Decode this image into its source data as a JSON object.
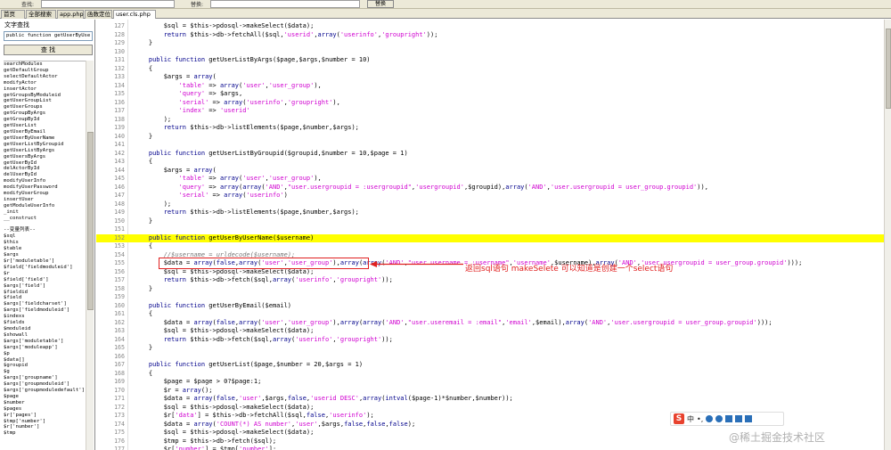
{
  "topbar": {
    "find_label": "查找:",
    "replace_label": "替换:",
    "replace_button": "替换"
  },
  "tabs": [
    "首页",
    "全部搜索",
    "app.php",
    "函数定位",
    "user.cls.php"
  ],
  "left_panel": {
    "title": "文字查找",
    "search_value": "public function getUserByUse",
    "find_button": "查 找",
    "items": [
      "searchModules",
      "getDefaultGroup",
      "selectDefaultActor",
      "modifyActor",
      "insertActor",
      "getGroupsByModuleid",
      "getUserGroupList",
      "getUserGroups",
      "getGroupByArgs",
      "getGroupById",
      "getUserList",
      "getUserByEmail",
      "getUserByUserName",
      "getUserListByGroupid",
      "getUserListByArgs",
      "getUsersByArgs",
      "getUserById",
      "delActorById",
      "delUserById",
      "modifyUserInfo",
      "modifyUserPassword",
      "modifyUserGroup",
      "insertUser",
      "getModuleUserInfo",
      "_init",
      "__construct",
      "",
      "--变量列表--",
      "$sql",
      "$this",
      "$table",
      "$args",
      "$r['moduletable']",
      "$field['fieldmoduleid']",
      "$r",
      "$field['field']",
      "$args['field']",
      "$fieldid",
      "$field",
      "$args['fieldcharset']",
      "$args['fieldmoduleid']",
      "$indexs",
      "$fields",
      "$moduleid",
      "$showall",
      "$args['moduletable']",
      "$args['moduleapp']",
      "$p",
      "$data[]",
      "$groupid",
      "$g",
      "$args['groupname']",
      "$args['groupmoduleid']",
      "$args['groupmoduledefault']",
      "$page",
      "$number",
      "$pages",
      "$r['pages']",
      "$tmp['number']",
      "$r['number']",
      "$tmp"
    ]
  },
  "editor": {
    "lines": [
      {
        "n": "127",
        "code": "        $sql = $this->pdosql->makeSelect($data);"
      },
      {
        "n": "128",
        "code": "        return $this->db->fetchAll($sql,'userid',array('userinfo','groupright'));"
      },
      {
        "n": "129",
        "code": "    }"
      },
      {
        "n": "130",
        "code": ""
      },
      {
        "n": "131",
        "code": "    public function getUserListByArgs($page,$args,$number = 10)"
      },
      {
        "n": "132",
        "code": "    {"
      },
      {
        "n": "133",
        "code": "        $args = array("
      },
      {
        "n": "134",
        "code": "            'table' => array('user','user_group'),"
      },
      {
        "n": "135",
        "code": "            'query' => $args,"
      },
      {
        "n": "136",
        "code": "            'serial' => array('userinfo','groupright'),"
      },
      {
        "n": "137",
        "code": "            'index' => 'userid'"
      },
      {
        "n": "138",
        "code": "        );"
      },
      {
        "n": "139",
        "code": "        return $this->db->listElements($page,$number,$args);"
      },
      {
        "n": "140",
        "code": "    }"
      },
      {
        "n": "141",
        "code": ""
      },
      {
        "n": "142",
        "code": "    public function getUserListByGroupid($groupid,$number = 10,$page = 1)"
      },
      {
        "n": "143",
        "code": "    {"
      },
      {
        "n": "144",
        "code": "        $args = array("
      },
      {
        "n": "145",
        "code": "            'table' => array('user','user_group'),"
      },
      {
        "n": "146",
        "code": "            'query' => array(array('AND',\"user.usergroupid = :usergroupid\",'usergroupid',$groupid),array('AND','user.usergroupid = user_group.groupid')),"
      },
      {
        "n": "147",
        "code": "            'serial' => array('userinfo')"
      },
      {
        "n": "148",
        "code": "        );"
      },
      {
        "n": "149",
        "code": "        return $this->db->listElements($page,$number,$args);"
      },
      {
        "n": "150",
        "code": "    }"
      },
      {
        "n": "151",
        "code": ""
      },
      {
        "n": "152",
        "code": "    public function getUserByUserName($username)"
      },
      {
        "n": "153",
        "code": "    {"
      },
      {
        "n": "154",
        "code": "        //$username = urldecode($username);"
      },
      {
        "n": "155",
        "code": "        $data = array(false,array('user','user_group'),array(array('AND',\"user.username = :username\",'username',$username),array('AND','user.usergroupid = user_group.groupid')));"
      },
      {
        "n": "156",
        "code": "        $sql = $this->pdosql->makeSelect($data);"
      },
      {
        "n": "157",
        "code": "        return $this->db->fetch($sql,array('userinfo','groupright'));"
      },
      {
        "n": "158",
        "code": "    }"
      },
      {
        "n": "159",
        "code": ""
      },
      {
        "n": "160",
        "code": "    public function getUserByEmail($email)"
      },
      {
        "n": "161",
        "code": "    {"
      },
      {
        "n": "162",
        "code": "        $data = array(false,array('user','user_group'),array(array('AND',\"user.useremail = :email\",'email',$email),array('AND','user.usergroupid = user_group.groupid')));"
      },
      {
        "n": "163",
        "code": "        $sql = $this->pdosql->makeSelect($data);"
      },
      {
        "n": "164",
        "code": "        return $this->db->fetch($sql,array('userinfo','groupright'));"
      },
      {
        "n": "165",
        "code": "    }"
      },
      {
        "n": "166",
        "code": ""
      },
      {
        "n": "167",
        "code": "    public function getUserList($page,$number = 20,$args = 1)"
      },
      {
        "n": "168",
        "code": "    {"
      },
      {
        "n": "169",
        "code": "        $page = $page > 0?$page:1;"
      },
      {
        "n": "170",
        "code": "        $r = array();"
      },
      {
        "n": "171",
        "code": "        $data = array(false,'user',$args,false,'userid DESC',array(intval($page-1)*$number,$number));"
      },
      {
        "n": "172",
        "code": "        $sql = $this->pdosql->makeSelect($data);"
      },
      {
        "n": "173",
        "code": "        $r['data'] = $this->db->fetchAll($sql,false,'userinfo');"
      },
      {
        "n": "174",
        "code": "        $data = array('COUNT(*) AS number','user',$args,false,false,false);"
      },
      {
        "n": "175",
        "code": "        $sql = $this->pdosql->makeSelect($data);"
      },
      {
        "n": "176",
        "code": "        $tmp = $this->db->fetch($sql);"
      },
      {
        "n": "177",
        "code": "        $r['number'] = $tmp['number'];"
      }
    ]
  },
  "annotation": {
    "text": "返回sql语句 makeSelete 可以知道是创建一个select语句",
    "color": "#e02020"
  },
  "ime": {
    "logo": "S",
    "mode": "中",
    "extra": "•,"
  },
  "watermark": "@稀土掘金技术社区"
}
